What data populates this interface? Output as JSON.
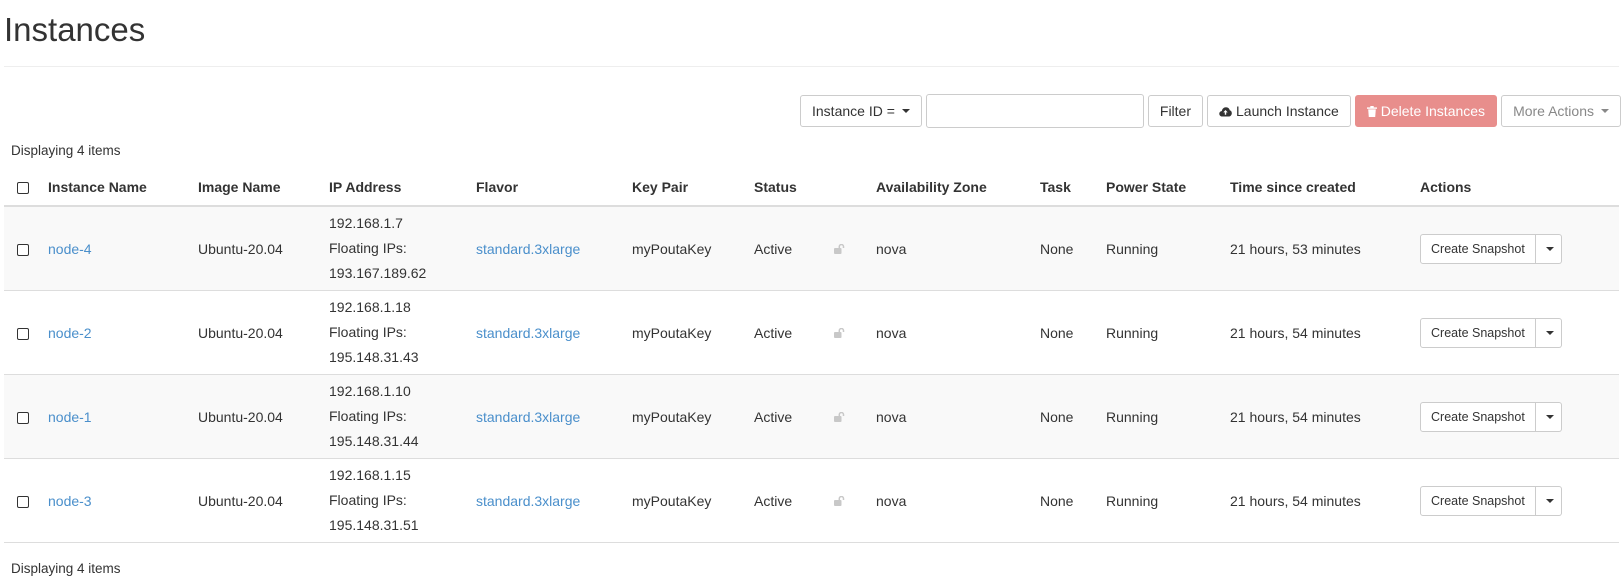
{
  "page": {
    "title": "Instances"
  },
  "toolbar": {
    "filter_field_label": "Instance ID =",
    "filter_input_value": "",
    "filter_button": "Filter",
    "launch_button": "Launch Instance",
    "delete_button": "Delete Instances",
    "more_actions_button": "More Actions"
  },
  "table": {
    "count_top": "Displaying 4 items",
    "count_bottom": "Displaying 4 items",
    "headers": {
      "name": "Instance Name",
      "image": "Image Name",
      "ip": "IP Address",
      "flavor": "Flavor",
      "keypair": "Key Pair",
      "status": "Status",
      "az": "Availability Zone",
      "task": "Task",
      "power": "Power State",
      "time": "Time since created",
      "actions": "Actions"
    },
    "rows": [
      {
        "name": "node-4",
        "image": "Ubuntu-20.04",
        "ip": "192.168.1.7",
        "floating_label": "Floating IPs:",
        "floating_ip": "193.167.189.62",
        "flavor": "standard.3xlarge",
        "keypair": "myPoutaKey",
        "status": "Active",
        "az": "nova",
        "task": "None",
        "power": "Running",
        "time": "21 hours, 53 minutes",
        "action": "Create Snapshot"
      },
      {
        "name": "node-2",
        "image": "Ubuntu-20.04",
        "ip": "192.168.1.18",
        "floating_label": "Floating IPs:",
        "floating_ip": "195.148.31.43",
        "flavor": "standard.3xlarge",
        "keypair": "myPoutaKey",
        "status": "Active",
        "az": "nova",
        "task": "None",
        "power": "Running",
        "time": "21 hours, 54 minutes",
        "action": "Create Snapshot"
      },
      {
        "name": "node-1",
        "image": "Ubuntu-20.04",
        "ip": "192.168.1.10",
        "floating_label": "Floating IPs:",
        "floating_ip": "195.148.31.44",
        "flavor": "standard.3xlarge",
        "keypair": "myPoutaKey",
        "status": "Active",
        "az": "nova",
        "task": "None",
        "power": "Running",
        "time": "21 hours, 54 minutes",
        "action": "Create Snapshot"
      },
      {
        "name": "node-3",
        "image": "Ubuntu-20.04",
        "ip": "192.168.1.15",
        "floating_label": "Floating IPs:",
        "floating_ip": "195.148.31.51",
        "flavor": "standard.3xlarge",
        "keypair": "myPoutaKey",
        "status": "Active",
        "az": "nova",
        "task": "None",
        "power": "Running",
        "time": "21 hours, 54 minutes",
        "action": "Create Snapshot"
      }
    ]
  },
  "icons": {
    "launch": "cloud-upload-icon",
    "delete": "trash-icon",
    "lock": "unlock-icon",
    "dropdown": "caret-down-icon"
  },
  "colors": {
    "link": "#4a8fcb",
    "danger": "#e88e8c",
    "row_stripe": "#f9f9f9"
  }
}
